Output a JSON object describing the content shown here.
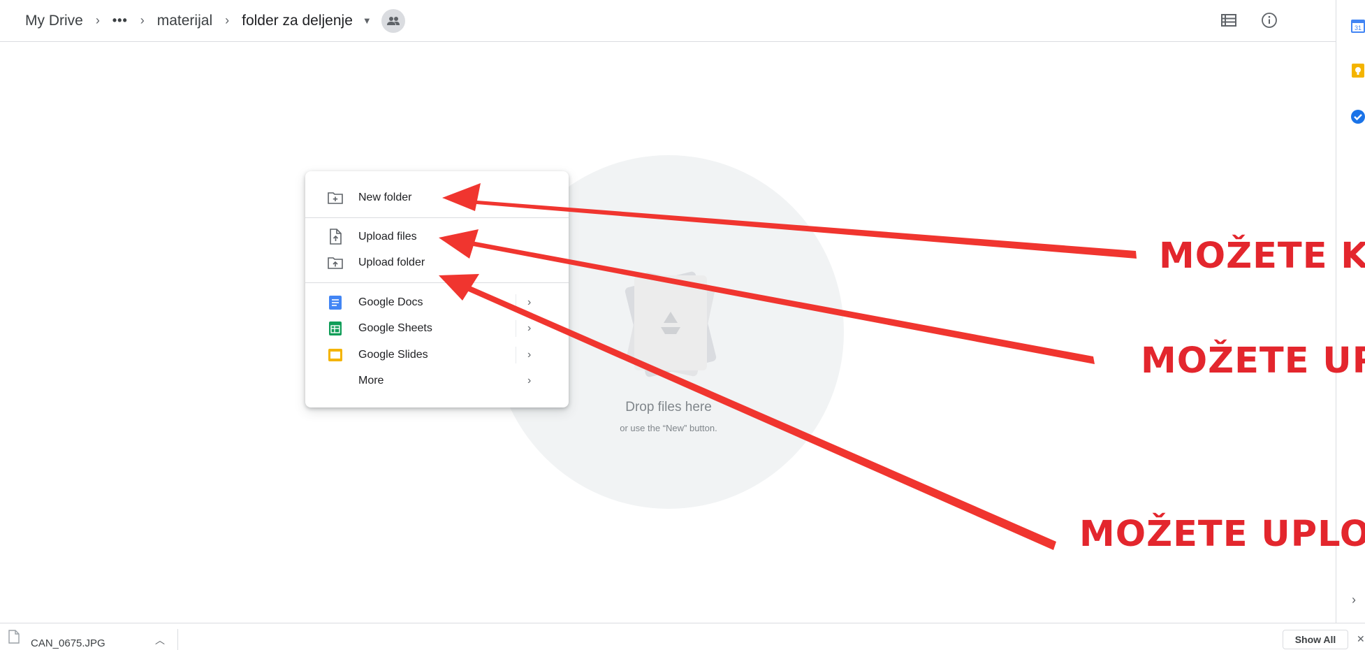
{
  "breadcrumb": {
    "root": "My Drive",
    "overflow": "•••",
    "parent": "materijal",
    "current": "folder za deljenje"
  },
  "toolbar": {
    "icons": [
      "list-view-icon",
      "info-icon"
    ]
  },
  "side_panel": {
    "icons": [
      "calendar-icon",
      "keep-icon",
      "tasks-icon"
    ],
    "calendar_day": "31"
  },
  "empty_state": {
    "title": "Drop files here",
    "subtitle": "or use the “New” button."
  },
  "new_menu": {
    "items": [
      {
        "label": "New folder",
        "icon": "new-folder-icon"
      },
      {
        "label": "Upload files",
        "icon": "upload-file-icon"
      },
      {
        "label": "Upload folder",
        "icon": "upload-folder-icon"
      },
      {
        "label": "Google Docs",
        "icon": "google-docs-icon",
        "color": "#4285f4"
      },
      {
        "label": "Google Sheets",
        "icon": "google-sheets-icon",
        "color": "#0f9d58"
      },
      {
        "label": "Google Slides",
        "icon": "google-slides-icon",
        "color": "#f4b400"
      },
      {
        "label": "More",
        "icon": ""
      }
    ]
  },
  "annotations": {
    "line1": "MOŽETE KI",
    "line2": "MOŽETE UP",
    "line3": "MOŽETE UPLO",
    "color": "#e3262d"
  },
  "download_bar": {
    "file_name": "CAN_0675.JPG",
    "show_all": "Show All"
  },
  "colors": {
    "accent_red": "#e3262d",
    "border": "#dadce0",
    "empty_bg": "#f1f3f4"
  }
}
